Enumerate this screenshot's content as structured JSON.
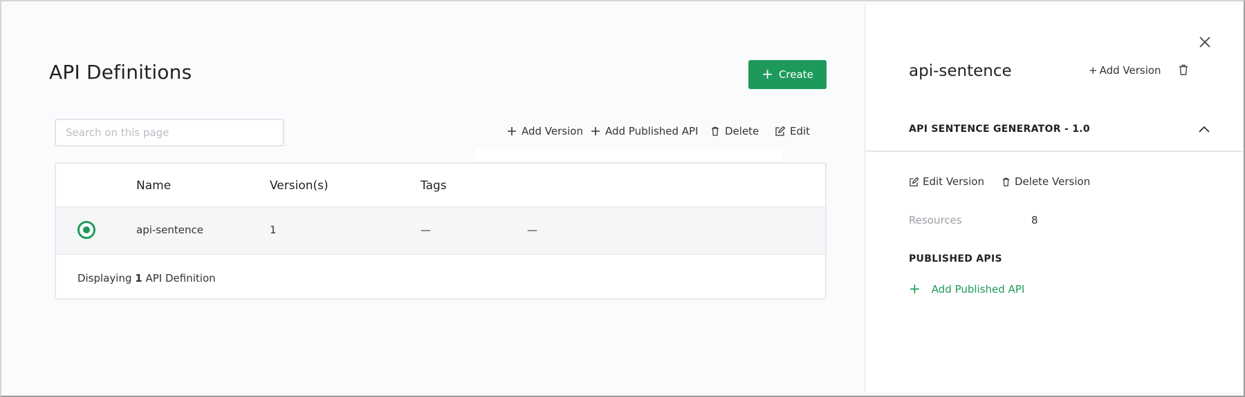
{
  "main": {
    "title": "API Definitions",
    "create_label": "Create",
    "search_placeholder": "Search on this page",
    "toolbar": {
      "add_version": "Add Version",
      "add_published_api": "Add Published API",
      "delete": "Delete",
      "edit": "Edit"
    },
    "table": {
      "headers": [
        "Name",
        "Version(s)",
        "Tags"
      ],
      "rows": [
        {
          "name": "api-sentence",
          "versions": "1",
          "tags": "—",
          "extra": "—",
          "selected": true
        }
      ]
    },
    "footer": {
      "prefix": "Displaying",
      "count": "1",
      "suffix": "API Definition"
    }
  },
  "panel": {
    "title": "api-sentence",
    "add_version": "Add Version",
    "section": "API SENTENCE GENERATOR - 1.0",
    "edit_version": "Edit Version",
    "delete_version": "Delete Version",
    "resources_label": "Resources",
    "resources_value": "8",
    "published_heading": "PUBLISHED APIS",
    "add_published": "Add Published API"
  },
  "colors": {
    "accent": "#1d9a5b",
    "row_selected": "#f5f6f7",
    "muted": "#9a9ea4"
  }
}
